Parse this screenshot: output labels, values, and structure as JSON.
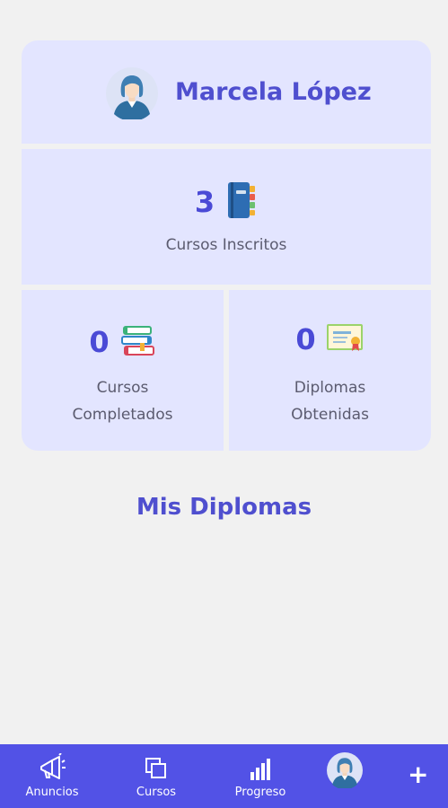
{
  "profile": {
    "name": "Marcela López",
    "avatar_icon": "female-avatar-icon"
  },
  "stats": {
    "enrolled": {
      "value": "3",
      "label": "Cursos Inscritos",
      "icon": "notebook-icon"
    },
    "completed": {
      "value": "0",
      "label_line1": "Cursos",
      "label_line2": "Completados",
      "icon": "stacked-books-icon"
    },
    "diplomas": {
      "value": "0",
      "label_line1": "Diplomas",
      "label_line2": "Obtenidas",
      "icon": "certificate-icon"
    }
  },
  "section_title": "Mis Diplomas",
  "bottom_nav": {
    "items": [
      {
        "label": "Anuncios",
        "icon": "megaphone-icon"
      },
      {
        "label": "Cursos",
        "icon": "courses-icon"
      },
      {
        "label": "Progreso",
        "icon": "bar-chart-icon"
      },
      {
        "label": "",
        "icon": "profile-avatar-icon"
      }
    ],
    "add_label": "+"
  },
  "colors": {
    "accent": "#5252e6",
    "panel": "#e3e5ff",
    "text_primary": "#4f4fcf",
    "background": "#f1f1f1"
  }
}
